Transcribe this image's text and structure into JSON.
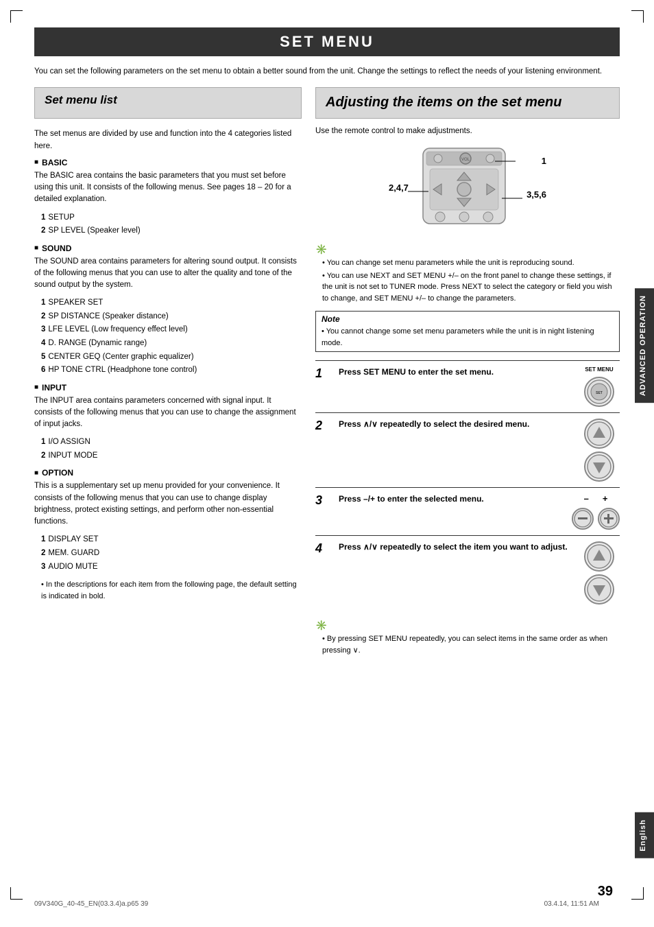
{
  "page": {
    "title": "SET MENU",
    "intro": "You can set the following parameters on the set menu to obtain a better sound from the unit. Change the settings to reflect the needs of your listening environment.",
    "set_menu_list": {
      "title": "Set menu list",
      "desc": "The set menus are divided by use and function into the 4 categories listed here.",
      "sections": [
        {
          "name": "BASIC",
          "desc": "The BASIC area contains the basic parameters that you must set before using this unit. It consists of the following menus. See pages 18 – 20 for a detailed explanation.",
          "items": [
            {
              "num": "1",
              "label": "SETUP"
            },
            {
              "num": "2",
              "label": "SP LEVEL (Speaker level)"
            }
          ]
        },
        {
          "name": "SOUND",
          "desc": "The SOUND area contains parameters for altering sound output. It consists of the following menus that you can use to alter the quality and tone of the sound output by the system.",
          "items": [
            {
              "num": "1",
              "label": "SPEAKER SET"
            },
            {
              "num": "2",
              "label": "SP DISTANCE (Speaker distance)"
            },
            {
              "num": "3",
              "label": "LFE LEVEL (Low frequency effect level)"
            },
            {
              "num": "4",
              "label": "D. RANGE (Dynamic range)"
            },
            {
              "num": "5",
              "label": "CENTER GEQ (Center graphic equalizer)"
            },
            {
              "num": "6",
              "label": "HP TONE CTRL (Headphone tone control)"
            }
          ]
        },
        {
          "name": "INPUT",
          "desc": "The INPUT area contains parameters concerned with signal input. It consists of the following menus that you can use to change the assignment of input jacks.",
          "items": [
            {
              "num": "1",
              "label": "I/O ASSIGN"
            },
            {
              "num": "2",
              "label": "INPUT MODE"
            }
          ]
        },
        {
          "name": "OPTION",
          "desc": "This is a supplementary set up menu provided for your convenience. It consists of the following menus that you can use to change display brightness, protect existing settings, and perform other non-essential functions.",
          "items": [
            {
              "num": "1",
              "label": "DISPLAY SET"
            },
            {
              "num": "2",
              "label": "MEM. GUARD"
            },
            {
              "num": "3",
              "label": "AUDIO MUTE"
            }
          ]
        }
      ],
      "footer_note": "In the descriptions for each item from the following page, the default setting is indicated in bold."
    },
    "adjusting": {
      "title": "Adjusting the items on the set menu",
      "use_remote": "Use the remote control to make adjustments.",
      "diagram_labels": {
        "label1": "1",
        "label247": "2,4,7",
        "label356": "3,5,6"
      },
      "tips": [
        "You can change set menu parameters while the unit is reproducing sound.",
        "You can use NEXT and SET MENU +/– on the front panel to change these settings, if the unit is not set to TUNER mode. Press NEXT to select the category or field you wish to change, and SET MENU +/– to change the parameters."
      ],
      "note": "You cannot change some set menu parameters while the unit is in night listening mode.",
      "steps": [
        {
          "num": "1",
          "title": "Press SET MENU to enter the set menu.",
          "button_label": "SET MENU"
        },
        {
          "num": "2",
          "title": "Press ∧/∨ repeatedly to select the desired menu.",
          "buttons": [
            "up",
            "down"
          ]
        },
        {
          "num": "3",
          "title": "Press –/+ to enter the selected menu.",
          "buttons": [
            "minus",
            "plus"
          ]
        },
        {
          "num": "4",
          "title": "Press ∧/∨ repeatedly to select the item you want to adjust.",
          "buttons": [
            "up",
            "down"
          ]
        }
      ],
      "bottom_tip": "By pressing SET MENU repeatedly, you can select items in the same order as when pressing ∨."
    },
    "sidebar_advanced": "ADVANCED OPERATION",
    "sidebar_english": "English",
    "page_number": "39",
    "footer_left": "09V340G_40-45_EN(03.3.4)a.p65          39",
    "footer_right": "03.4.14, 11:51 AM"
  }
}
